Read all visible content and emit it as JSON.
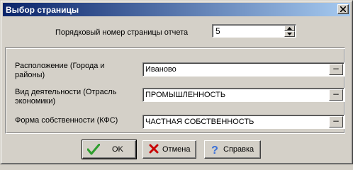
{
  "window": {
    "title": "Выбор страницы",
    "close_icon": "close-icon"
  },
  "page_number": {
    "label": "Порядковый номер страницы отчета",
    "value": "5"
  },
  "filters": [
    {
      "label_line1": "Расположение (Города и",
      "label_line2": "районы)",
      "value": "Иваново",
      "button": "..."
    },
    {
      "label_line1": "Вид деятельности (Отрасль",
      "label_line2": "экономики)",
      "value": "ПРОМЫШЛЕННОСТЬ",
      "button": "..."
    },
    {
      "label_line1": "Форма собственности (КФС)",
      "label_line2": "",
      "value": "ЧАСТНАЯ СОБСТВЕННОСТЬ",
      "button": "..."
    }
  ],
  "buttons": {
    "ok": {
      "label": "OK",
      "icon": "checkmark-icon",
      "color": "#2e9e2e"
    },
    "cancel": {
      "label": "Отмена",
      "icon": "x-icon",
      "color": "#c80000"
    },
    "help": {
      "label": "Справка",
      "icon": "question-mark-icon",
      "color": "#3a6fd8"
    }
  },
  "colors": {
    "titlebar_start": "#0a246a",
    "titlebar_end": "#a6caf0",
    "face": "#d4d0c8"
  }
}
